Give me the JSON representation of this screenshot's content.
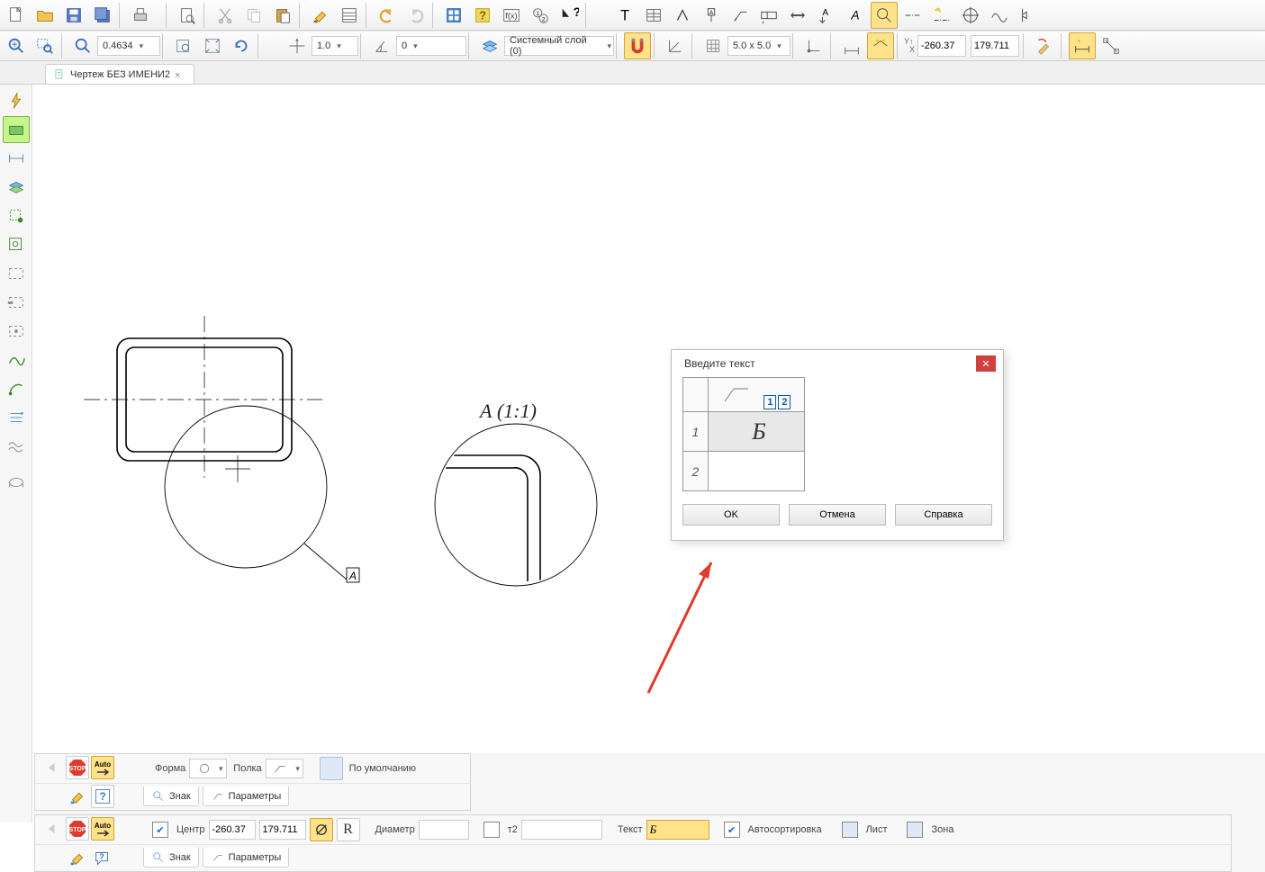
{
  "app": {
    "document_tab": "Чертеж БЕЗ ИМЕНИ2"
  },
  "toolbar": {
    "zoom_value": "0.4634",
    "scale_value": "1.0",
    "secondary_value": "0",
    "layer_value": "Системный слой (0)",
    "grid_value": "5.0 x 5.0",
    "coord_x": "-260.37",
    "coord_y": "179.711"
  },
  "view": {
    "section_label": "А (1:1)",
    "detail_letter": "А"
  },
  "dialog": {
    "title": "Введите текст",
    "row1_num": "1",
    "row1_text": "Б",
    "row2_num": "2",
    "row2_text": "",
    "num1": "1",
    "num2": "2",
    "ok": "OK",
    "cancel": "Отмена",
    "help": "Справка"
  },
  "panel1": {
    "form_lbl": "Форма",
    "shelf_lbl": "Полка",
    "default_lbl": "По умолчанию",
    "tab_sign": "Знак",
    "tab_params": "Параметры"
  },
  "panel2": {
    "center_lbl": "Центр",
    "center_x": "-260.37",
    "center_y": "179.711",
    "diam_lbl": "Диаметр",
    "diam_val": "",
    "t2_lbl": "т2",
    "t2_val": "",
    "text_lbl": "Текст",
    "text_val": "Б",
    "autosort_lbl": "Автосортировка",
    "sheet_lbl": "Лист",
    "zone_lbl": "Зона",
    "tab_sign": "Знак",
    "tab_params": "Параметры"
  },
  "icons": {
    "auto": "Auto"
  }
}
